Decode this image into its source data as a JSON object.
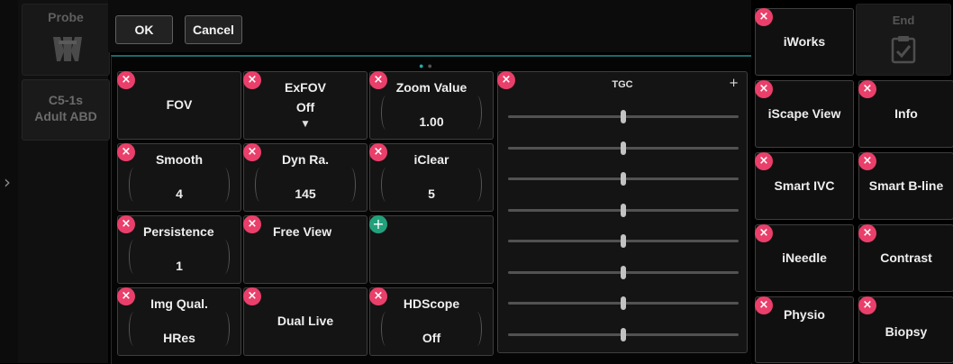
{
  "left": {
    "probe_label": "Probe",
    "preset_line1": "C5-1s",
    "preset_line2": "Adult ABD",
    "expand_glyph": "›"
  },
  "top": {
    "ok": "OK",
    "cancel": "Cancel"
  },
  "grid": {
    "fov": {
      "title": "FOV"
    },
    "exfov": {
      "title": "ExFOV",
      "value": "Off"
    },
    "zoom": {
      "title": "Zoom Value",
      "value": "1.00"
    },
    "smooth": {
      "title": "Smooth",
      "value": "4"
    },
    "dynra": {
      "title": "Dyn Ra.",
      "value": "145"
    },
    "iclear": {
      "title": "iClear",
      "value": "5"
    },
    "persistence": {
      "title": "Persistence",
      "value": "1"
    },
    "freeview": {
      "title": "Free View"
    },
    "imgqual": {
      "title": "Img Qual.",
      "value": "HRes"
    },
    "duallive": {
      "title": "Dual Live"
    },
    "hdscope": {
      "title": "HDScope",
      "value": "Off"
    }
  },
  "tgc": {
    "title": "TGC",
    "plus": "+",
    "levels": [
      0.5,
      0.5,
      0.5,
      0.5,
      0.5,
      0.5,
      0.5,
      0.5
    ]
  },
  "right": {
    "end": "End",
    "iworks": "iWorks",
    "iscape": "iScape View",
    "info": "Info",
    "smartivc": "Smart IVC",
    "smartbline": "Smart B-line",
    "ineedle": "iNeedle",
    "contrast": "Contrast",
    "physio": "Physio",
    "biopsy": "Biopsy"
  },
  "icons": {
    "remove": "×",
    "add": "+",
    "dropdown": "▼"
  },
  "colors": {
    "remove_badge": "#ea3f6a",
    "add_badge": "#22a07c",
    "accent": "#1a6a6a",
    "page_dot_active": "#22aaaa"
  }
}
